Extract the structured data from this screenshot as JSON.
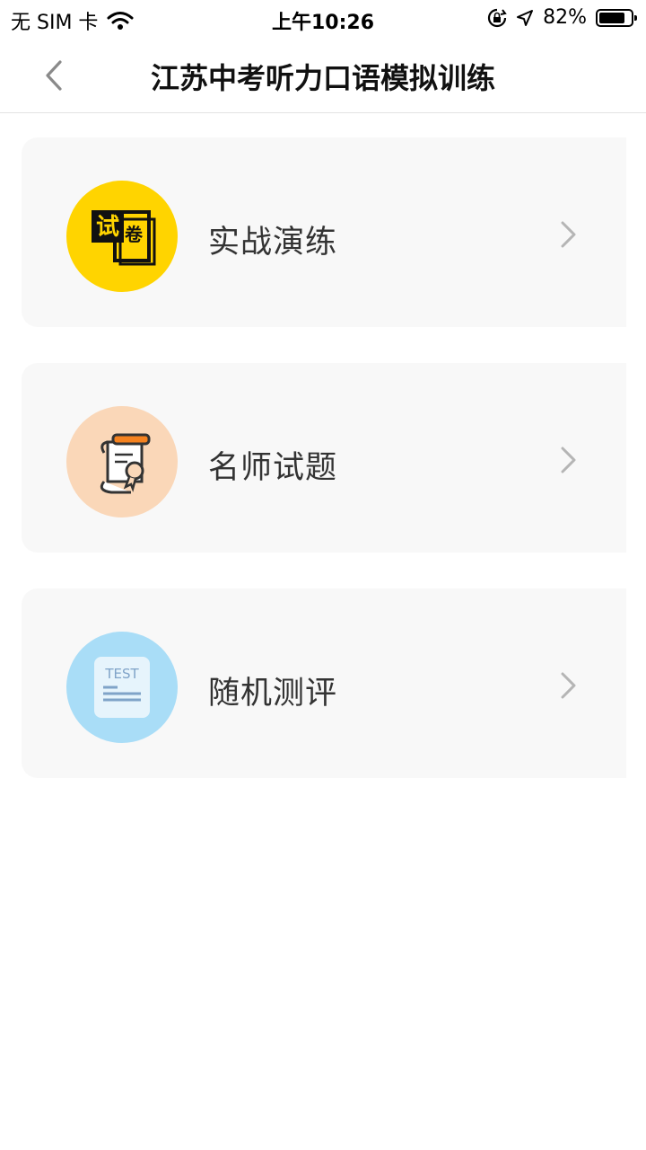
{
  "status_bar": {
    "carrier": "无 SIM 卡",
    "time": "上午10:26",
    "battery_text": "82%",
    "battery_level": 0.82
  },
  "nav": {
    "title": "江苏中考听力口语模拟训练",
    "back_icon": "chevron-left-icon"
  },
  "menu": [
    {
      "label": "实战演练",
      "icon": "exam-paper-icon",
      "icon_text": [
        "试",
        "卷"
      ],
      "icon_bg": "#FFD400"
    },
    {
      "label": "名师试题",
      "icon": "certificate-scroll-icon",
      "icon_bg": "#FAD7B8"
    },
    {
      "label": "随机测评",
      "icon": "test-sheet-icon",
      "icon_text": "TEST",
      "icon_bg": "#A9DDF7"
    }
  ],
  "colors": {
    "card_bg": "#f8f8f8",
    "label": "#333333",
    "chevron": "#b5b5b5"
  }
}
